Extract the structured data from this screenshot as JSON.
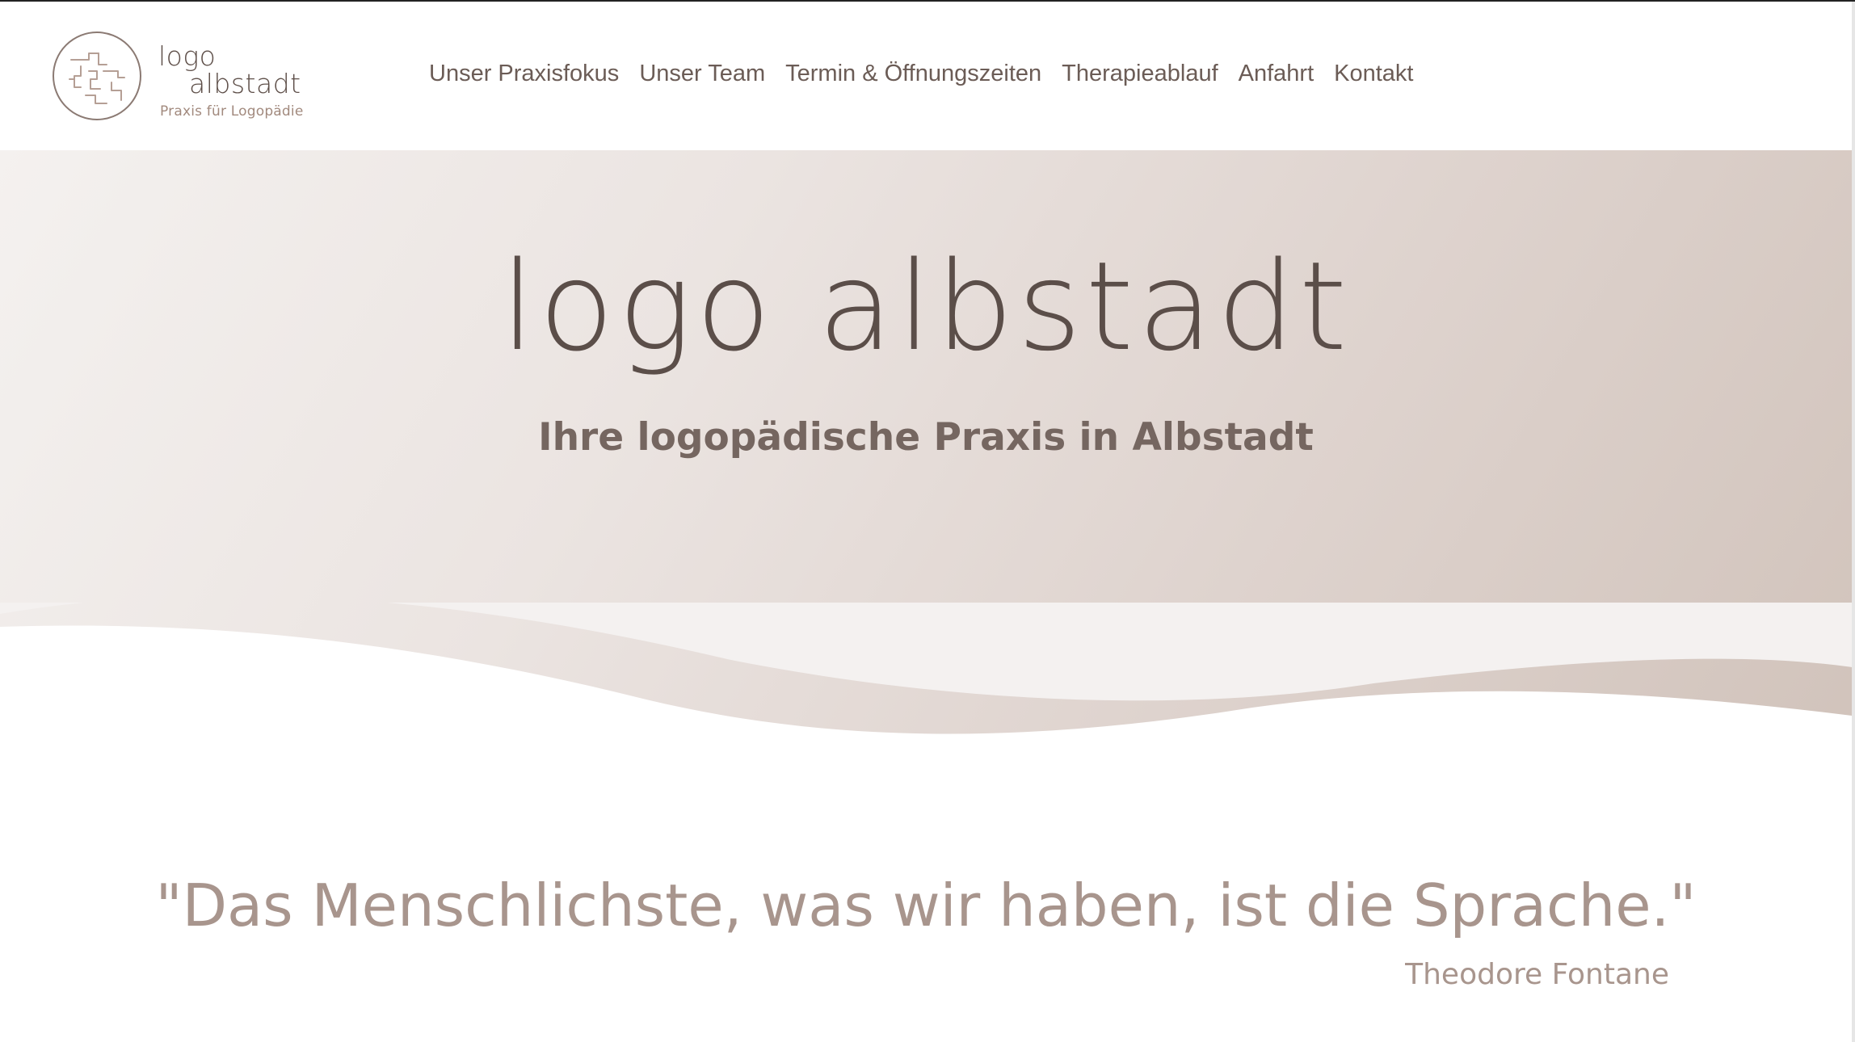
{
  "brand": {
    "line1": "logo",
    "line2": "albstadt",
    "tagline": "Praxis für Logopädie",
    "logo_icon": "puzzle-circle-logo-icon"
  },
  "nav": {
    "items": [
      {
        "label": "Unser Praxisfokus"
      },
      {
        "label": "Unser Team"
      },
      {
        "label": "Termin & Öffnungszeiten"
      },
      {
        "label": "Therapieablauf"
      },
      {
        "label": "Anfahrt"
      },
      {
        "label": "Kontakt"
      }
    ]
  },
  "hero": {
    "title": "logo albstadt",
    "subtitle": "Ihre logopädische Praxis in Albstadt"
  },
  "quote": {
    "text": "\"Das Menschlichste, was wir haben, ist die Sprache.\"",
    "author": "Theodore Fontane"
  },
  "colors": {
    "text_dark": "#5b4e49",
    "accent": "#a8958d",
    "hero_gradient_start": "#f4f1ef",
    "hero_gradient_end": "#d1c3bb"
  }
}
